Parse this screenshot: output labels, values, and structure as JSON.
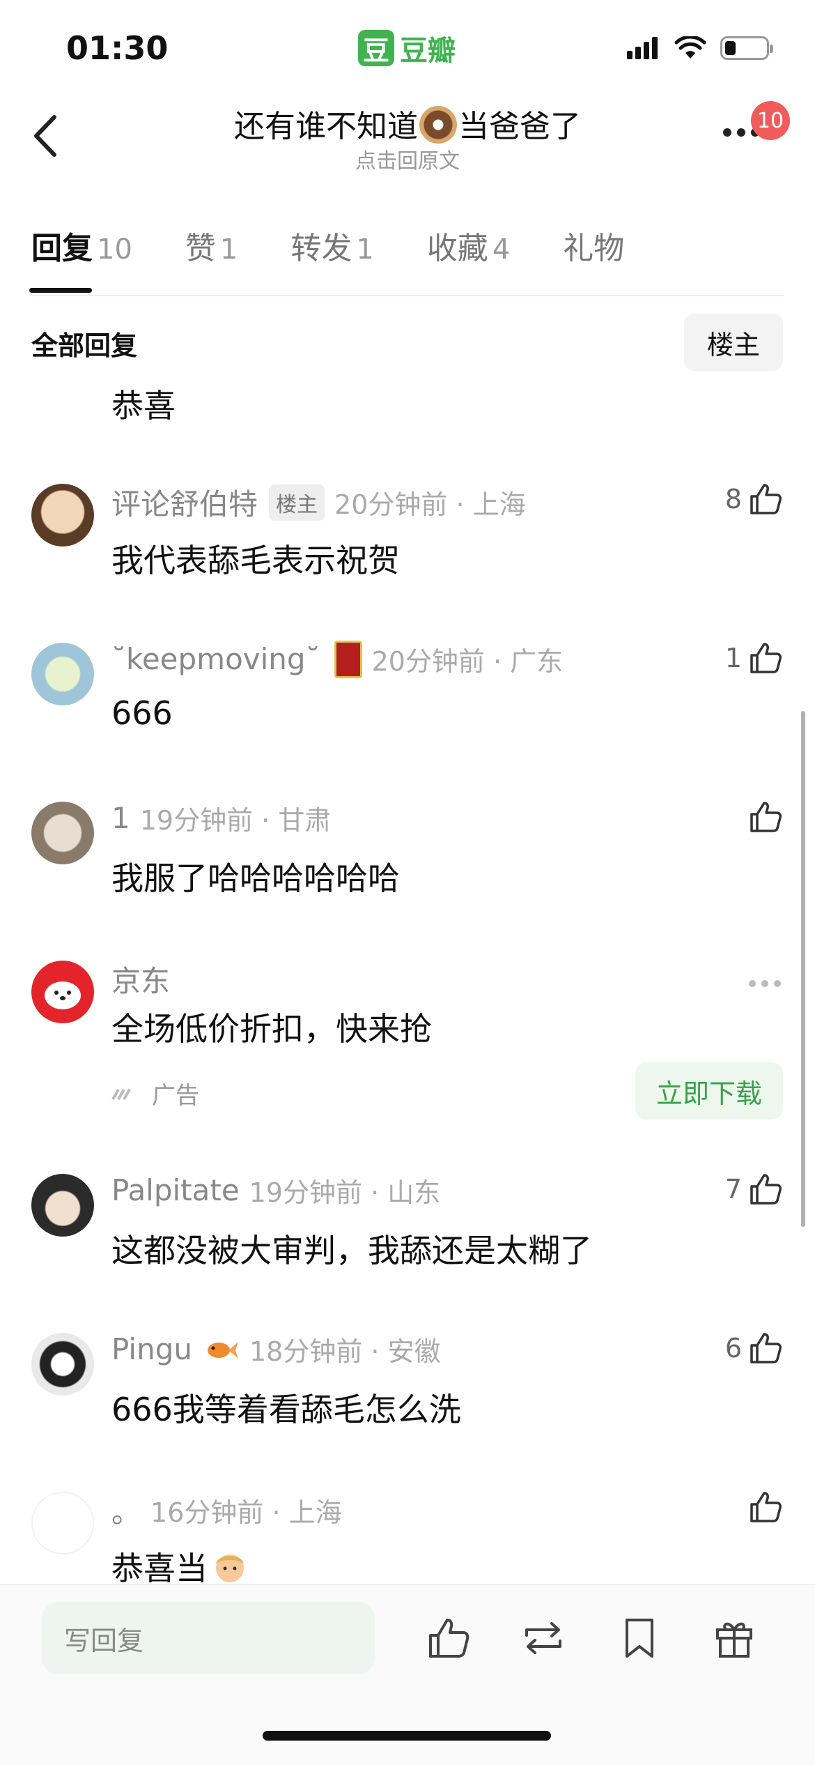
{
  "status": {
    "time": "01:30",
    "app_logo_char": "豆",
    "app_name": "豆瓣",
    "battery_level": 0.25
  },
  "nav": {
    "title_before": "还有谁不知道",
    "title_after": "当爸爸了",
    "subtitle": "点击回原文",
    "notification_count": "10"
  },
  "tabs": [
    {
      "label": "回复",
      "count": "10",
      "active": true
    },
    {
      "label": "赞",
      "count": "1"
    },
    {
      "label": "转发",
      "count": "1"
    },
    {
      "label": "收藏",
      "count": "4"
    },
    {
      "label": "礼物",
      "count": ""
    }
  ],
  "section": {
    "title": "全部回复",
    "filter_label": "楼主"
  },
  "partial_comment": {
    "text": "恭喜"
  },
  "comments": [
    {
      "name": "评论舒伯特",
      "tag": "楼主",
      "meta": "20分钟前 · 上海",
      "text": "我代表舔毛表示祝贺",
      "likes": "8"
    },
    {
      "name": "˘keepmoving˘",
      "meta": "20分钟前 · 广东",
      "text": "666",
      "likes": "1"
    },
    {
      "name": "1",
      "meta": "19分钟前 · 甘肃",
      "text": "我服了哈哈哈哈哈哈",
      "likes": ""
    },
    {
      "name": "Palpitate",
      "meta": "19分钟前 · 山东",
      "text": "这都没被大审判，我舔还是太糊了",
      "likes": "7"
    },
    {
      "name": "Pingu",
      "meta": "18分钟前 · 安徽",
      "text": "666我等着看舔毛怎么洗",
      "likes": "6"
    },
    {
      "name": "。",
      "meta": "16分钟前 · 上海",
      "text": "恭喜当",
      "likes": ""
    }
  ],
  "ad": {
    "name": "京东",
    "text": "全场低价折扣，快来抢",
    "label": "广告",
    "button": "立即下载"
  },
  "bottom_bar": {
    "reply_placeholder": "写回复"
  },
  "colors": {
    "brand_green": "#3fb34f",
    "badge_red": "#f25b5b"
  }
}
